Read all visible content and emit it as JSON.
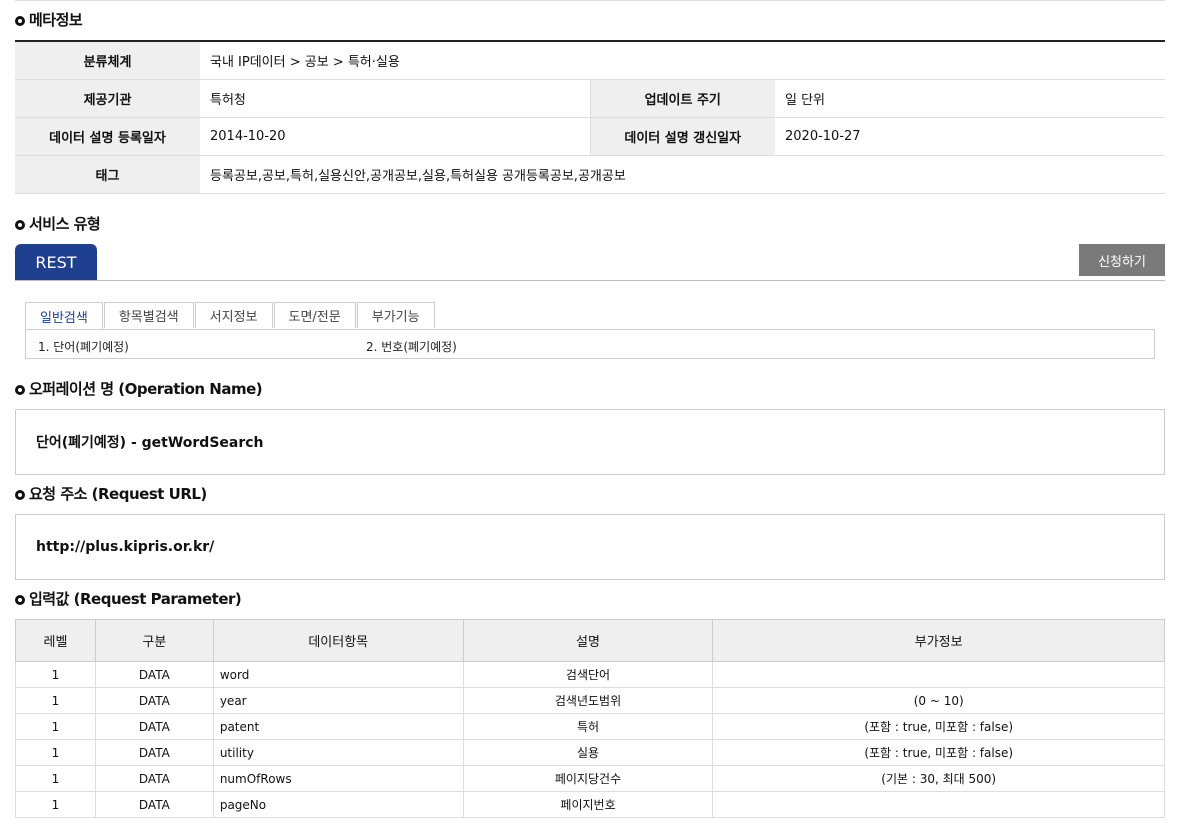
{
  "meta_section": {
    "title": "메타정보",
    "rows": [
      [
        {
          "label": "분류체계",
          "value": "국내 IP데이터 > 공보 > 특허·실용"
        }
      ],
      [
        {
          "label": "제공기관",
          "value": "특허청"
        },
        {
          "label": "업데이트 주기",
          "value": "일 단위"
        }
      ],
      [
        {
          "label": "데이터 설명 등록일자",
          "value": "2014-10-20"
        },
        {
          "label": "데이터 설명 갱신일자",
          "value": "2020-10-27"
        }
      ],
      [
        {
          "label": "태그",
          "value": "등록공보,공보,특허,실용신안,공개공보,실용,특허실용 공개등록공보,공개공보"
        }
      ]
    ]
  },
  "service_section": {
    "title": "서비스 유형",
    "tab_label": "REST",
    "apply_button": "신청하기",
    "subtabs": [
      "일반검색",
      "항목별검색",
      "서지정보",
      "도면/전문",
      "부가기능"
    ],
    "active_subtab": 0,
    "items": [
      "1. 단어(폐기예정)",
      "2. 번호(폐기예정)"
    ]
  },
  "operation_section": {
    "title": "오퍼레이션 명 (Operation Name)",
    "value": "단어(폐기예정) - getWordSearch"
  },
  "request_url_section": {
    "title": "요청 주소 (Request URL)",
    "value": "http://plus.kipris.or.kr/"
  },
  "param_section": {
    "title": "입력값 (Request Parameter)",
    "headers": [
      "레벨",
      "구분",
      "데이터항목",
      "설명",
      "부가정보"
    ],
    "rows": [
      [
        "1",
        "DATA",
        "word",
        "검색단어",
        ""
      ],
      [
        "1",
        "DATA",
        "year",
        "검색년도범위",
        "(0 ~ 10)"
      ],
      [
        "1",
        "DATA",
        "patent",
        "특허",
        "(포함 : true, 미포함 : false)"
      ],
      [
        "1",
        "DATA",
        "utility",
        "실용",
        "(포함 : true, 미포함 : false)"
      ],
      [
        "1",
        "DATA",
        "numOfRows",
        "페이지당건수",
        "(기본 : 30, 최대 500)"
      ],
      [
        "1",
        "DATA",
        "pageNo",
        "페이지번호",
        ""
      ]
    ]
  }
}
